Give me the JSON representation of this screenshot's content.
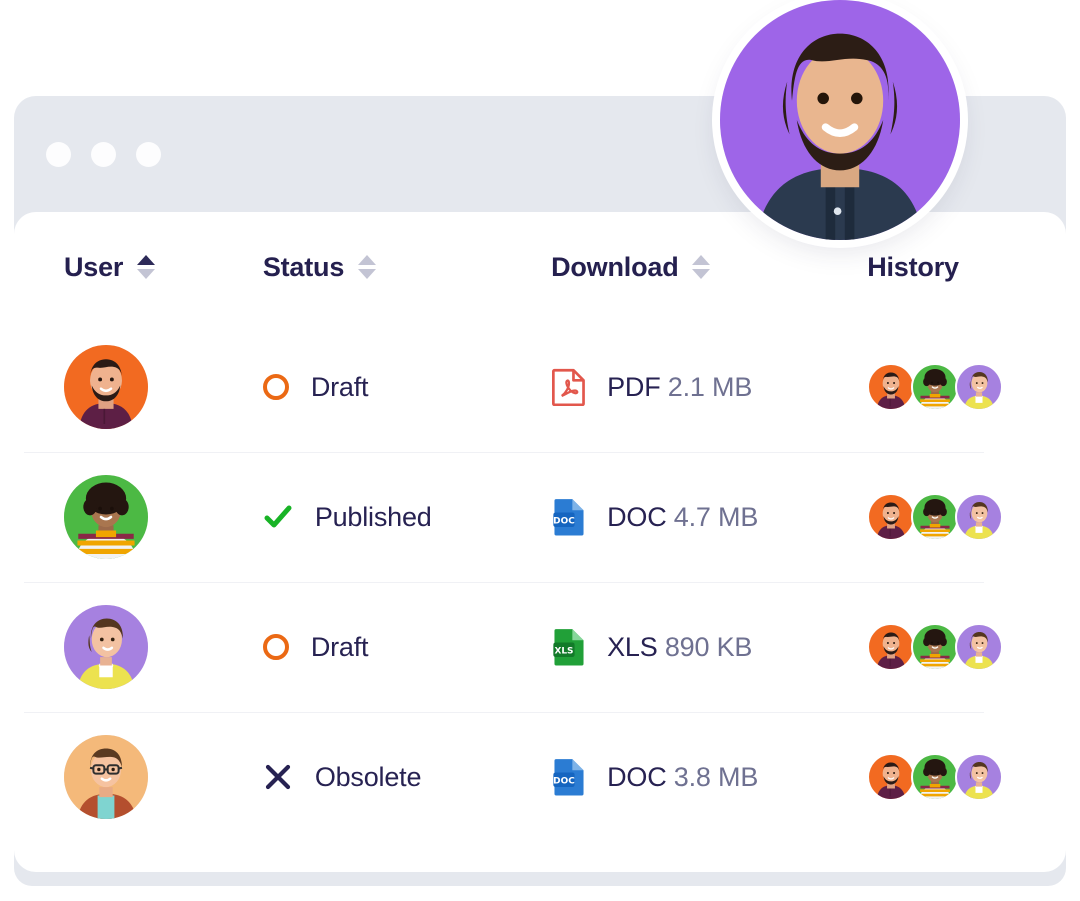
{
  "window": {
    "dots": [
      "window-dot-1",
      "window-dot-2",
      "window-dot-3"
    ],
    "chrome_color": "#e5e8ee"
  },
  "profile": {
    "name": "profile-avatar",
    "background": "#9e65e8",
    "alt": "Smiling man with curly dark hair and beard wearing a dark denim shirt"
  },
  "table": {
    "columns": [
      {
        "label": "User",
        "sortable": true,
        "sort": "asc"
      },
      {
        "label": "Status",
        "sortable": true,
        "sort": "none"
      },
      {
        "label": "Download",
        "sortable": true,
        "sort": "none"
      },
      {
        "label": "History",
        "sortable": false,
        "sort": "none"
      }
    ],
    "rows": [
      {
        "user_avatar": "avatar-orange-man",
        "status": {
          "label": "Draft",
          "icon": "circle-outline-icon",
          "color": "#eb6914"
        },
        "download": {
          "type": "PDF",
          "size": "2.1 MB",
          "icon": "pdf-file-icon",
          "color": "#e2574c"
        },
        "history": [
          "avatar-orange-man",
          "avatar-green-woman",
          "avatar-purple-woman"
        ]
      },
      {
        "user_avatar": "avatar-green-woman",
        "status": {
          "label": "Published",
          "icon": "check-icon",
          "color": "#18b326"
        },
        "download": {
          "type": "DOC",
          "size": "4.7 MB",
          "icon": "doc-file-icon",
          "color": "#2b7cd3"
        },
        "history": [
          "avatar-orange-man",
          "avatar-green-woman",
          "avatar-purple-woman"
        ]
      },
      {
        "user_avatar": "avatar-purple-woman",
        "status": {
          "label": "Draft",
          "icon": "circle-outline-icon",
          "color": "#eb6914"
        },
        "download": {
          "type": "XLS",
          "size": "890 KB",
          "icon": "xls-file-icon",
          "color": "#1a9c34"
        },
        "history": [
          "avatar-orange-man",
          "avatar-green-woman",
          "avatar-purple-woman"
        ]
      },
      {
        "user_avatar": "avatar-peach-man-glasses",
        "status": {
          "label": "Obsolete",
          "icon": "x-icon",
          "color": "#272252"
        },
        "download": {
          "type": "DOC",
          "size": "3.8 MB",
          "icon": "doc-file-icon",
          "color": "#2b7cd3"
        },
        "history": [
          "avatar-orange-man",
          "avatar-green-woman",
          "avatar-purple-woman"
        ]
      }
    ]
  },
  "colors": {
    "heading": "#25204f",
    "body": "#272252",
    "muted": "#6f7191",
    "divider": "#f0f1f5",
    "card": "#ffffff"
  }
}
